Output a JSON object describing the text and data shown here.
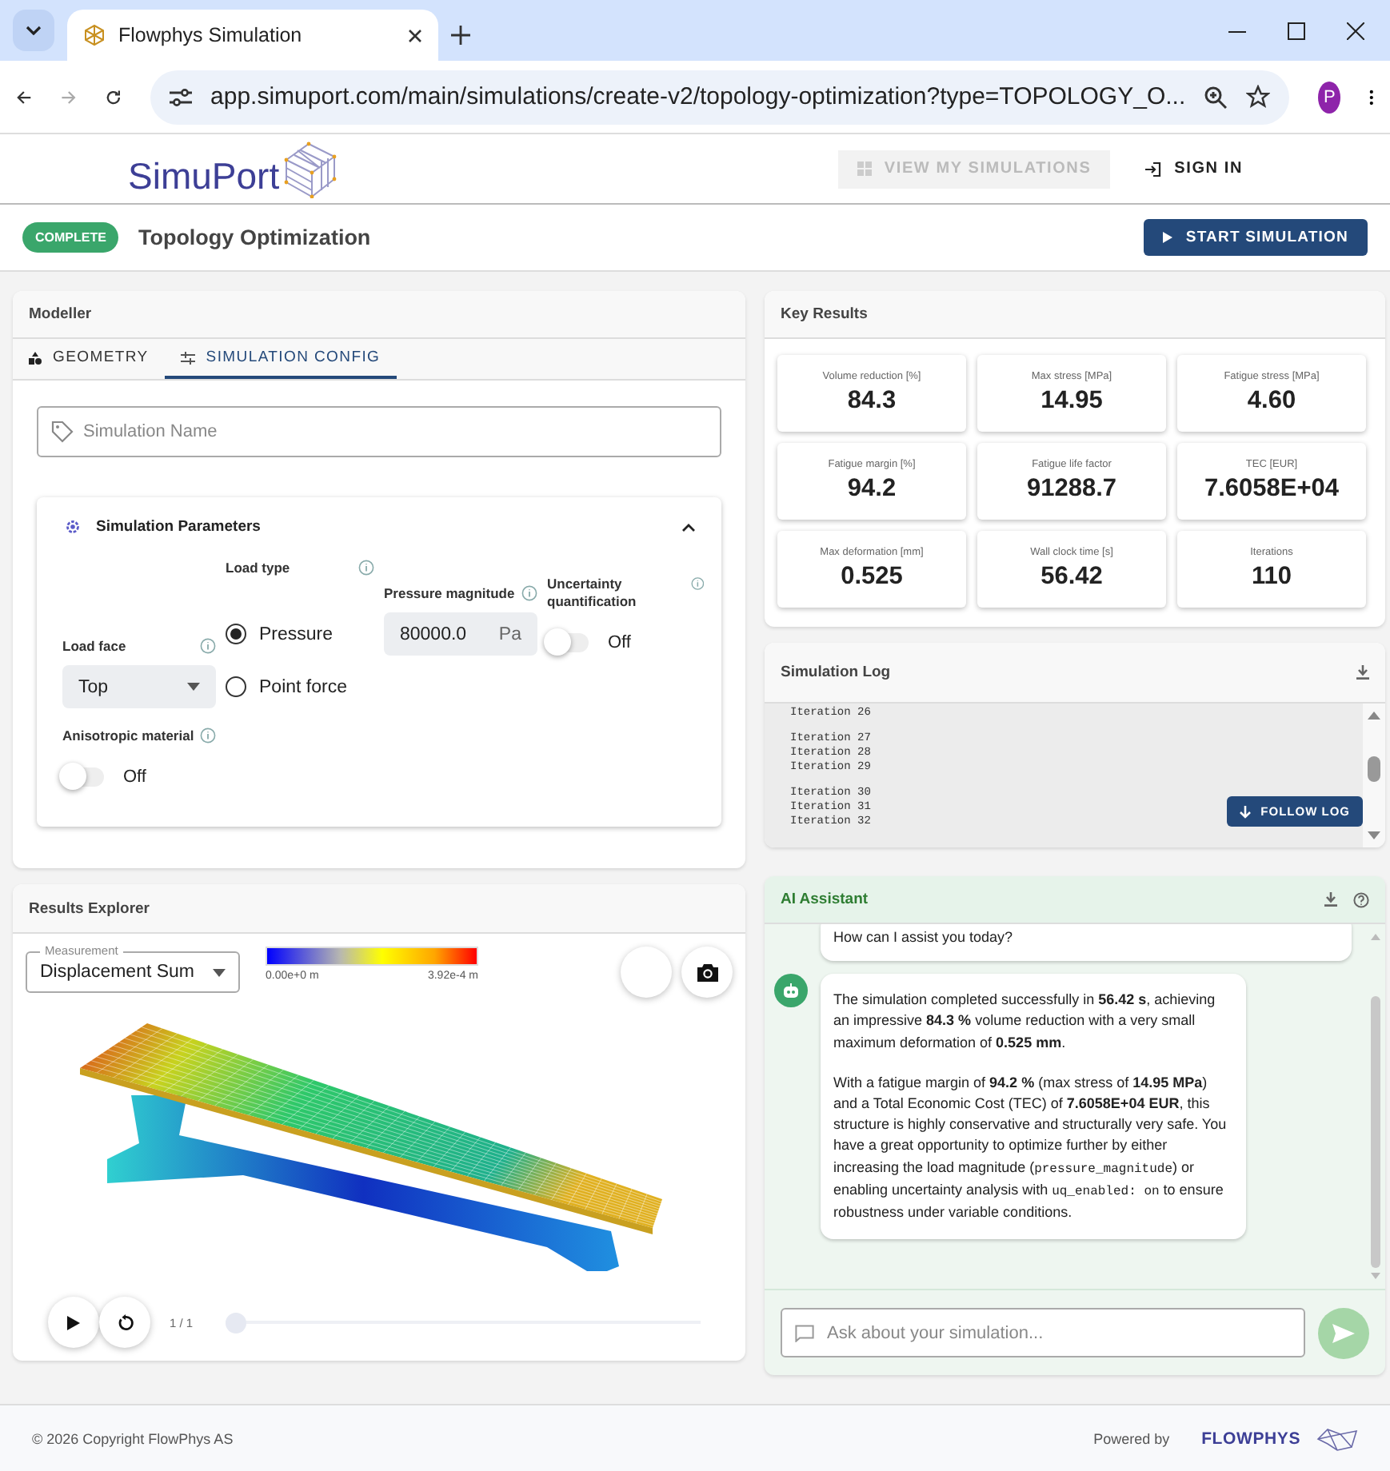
{
  "browser": {
    "tab_title": "Flowphys Simulation",
    "url": "app.simuport.com/main/simulations/create-v2/topology-optimization?type=TOPOLOGY_O...",
    "profile": "P"
  },
  "header": {
    "logo": "SimuPort",
    "nav": [
      {
        "label": "VIEW MY SIMULATIONS",
        "disabled": true,
        "kind": "grid"
      },
      {
        "label": "SIGN IN",
        "disabled": false,
        "kind": "login"
      }
    ]
  },
  "subheader": {
    "status": "COMPLETE",
    "title": "Topology Optimization",
    "action": "START SIMULATION"
  },
  "modeller": {
    "title": "Modeller",
    "tabs": [
      {
        "label": "GEOMETRY",
        "selected": false,
        "kind": "shapes"
      },
      {
        "label": "SIMULATION CONFIG",
        "selected": true,
        "kind": "sliders"
      }
    ],
    "name_field": {
      "placeholder": "Simulation Name"
    },
    "params": {
      "title": "Simulation Parameters",
      "expanded": true,
      "load_face": {
        "label": "Load face",
        "value": "Top"
      },
      "load_type": {
        "label": "Load type",
        "options": [
          {
            "label": "Pressure",
            "selected": true
          },
          {
            "label": "Point force",
            "selected": false
          }
        ]
      },
      "pressure": {
        "label": "Pressure magnitude",
        "value": "80000.0",
        "unit": "Pa"
      },
      "uncertainty": {
        "label": "Uncertainty quantification",
        "on": false,
        "state_label": "Off"
      },
      "anisotropic": {
        "label": "Anisotropic material",
        "on": false,
        "state_label": "Off"
      }
    }
  },
  "results_explorer": {
    "title": "Results Explorer",
    "measurement": {
      "label": "Measurement",
      "value": "Displacement Sum"
    },
    "colorbar": {
      "min": "0.00e+0 m",
      "max": "3.92e-4 m"
    },
    "frame": "1 / 1",
    "timeline": {
      "level": 0
    }
  },
  "key_results": {
    "title": "Key Results",
    "cards": [
      {
        "label": "Volume reduction [%]",
        "value": "84.3"
      },
      {
        "label": "Max stress [MPa]",
        "value": "14.95"
      },
      {
        "label": "Fatigue stress [MPa]",
        "value": "4.60"
      },
      {
        "label": "Fatigue margin [%]",
        "value": "94.2"
      },
      {
        "label": "Fatigue life factor",
        "value": "91288.7"
      },
      {
        "label": "TEC [EUR]",
        "value": "7.6058E+04"
      },
      {
        "label": "Max deformation [mm]",
        "value": "0.525"
      },
      {
        "label": "Wall clock time [s]",
        "value": "56.42"
      },
      {
        "label": "Iterations",
        "value": "110"
      }
    ]
  },
  "simulation_log": {
    "title": "Simulation Log",
    "groups": [
      [
        "Iteration 26"
      ],
      [
        "Iteration 27",
        "Iteration 28",
        "Iteration 29"
      ],
      [
        "Iteration 30",
        "Iteration 31",
        "Iteration 32"
      ]
    ],
    "follow": "FOLLOW LOG"
  },
  "assistant": {
    "title": "AI Assistant",
    "messages": [
      {
        "avatar": false,
        "paragraphs": [
          [
            {
              "kind": "text",
              "text": "How can I assist you today?"
            }
          ]
        ]
      },
      {
        "avatar": true,
        "paragraphs": [
          [
            {
              "kind": "text",
              "text": "The simulation completed successfully in **56.42 s**, achieving an impressive **84.3 %** volume reduction with a very small maximum deformation of **0.525 mm**."
            }
          ],
          [
            {
              "kind": "text",
              "text": "With a fatigue margin of **94.2 %** (max stress of **14.95 MPa**) and a Total Economic Cost (TEC) of **7.6058E+04 EUR**, this structure is highly conservative and structurally very safe. You have a great opportunity to optimize further by either increasing the load magnitude ("
            },
            {
              "kind": "code",
              "text": "pressure_magnitude"
            },
            {
              "kind": "text",
              "text": ") or enabling uncertainty analysis with "
            },
            {
              "kind": "code",
              "text": "uq_enabled: on"
            },
            {
              "kind": "text",
              "text": " to ensure robustness under variable conditions."
            }
          ]
        ]
      }
    ],
    "input": {
      "placeholder": "Ask about your simulation..."
    }
  },
  "footer": {
    "copyright": "© 2026 Copyright FlowPhys AS",
    "powered": "Powered by",
    "brand": "FLOWPHYS"
  }
}
